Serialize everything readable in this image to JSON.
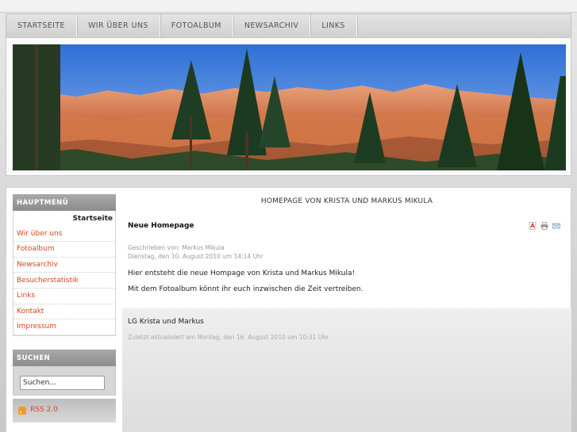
{
  "nav": {
    "items": [
      "STARTSEITE",
      "WIR ÜBER UNS",
      "FOTOALBUM",
      "NEWSARCHIV",
      "LINKS"
    ]
  },
  "banner": {
    "icon": "canyon-panorama-image"
  },
  "sidebar": {
    "menu_title": "HAUPTMENÜ",
    "items": [
      "Startseite",
      "Wir über uns",
      "Fotoalbum",
      "Newsarchiv",
      "Besucherstatistik",
      "Links",
      "Kontakt",
      "Impressum"
    ],
    "search_title": "SUCHEN",
    "search_value": "Suchen...",
    "rss_label": "RSS 2.0"
  },
  "content": {
    "page_title": "HOMEPAGE VON KRISTA UND MARKUS MIKULA",
    "article_title": "Neue Homepage",
    "author": "Geschrieben von: Markus Mikula",
    "date": "Dienstag, den 10. August 2010 um 14:14 Uhr",
    "paragraph1": "Hier entsteht die neue Hompage von Krista und Markus Mikula!",
    "paragraph2": "Mit dem Fotoalbum könnt ihr euch inzwischen die Zeit vertreiben.",
    "signature": "LG Krista und Markus",
    "updated": "Zuletzt aktualisiert am Montag, den 16. August 2010 um 10:31 Uhr"
  },
  "colors": {
    "link": "#d5461f",
    "accent_grey": "#8c8c8c"
  }
}
